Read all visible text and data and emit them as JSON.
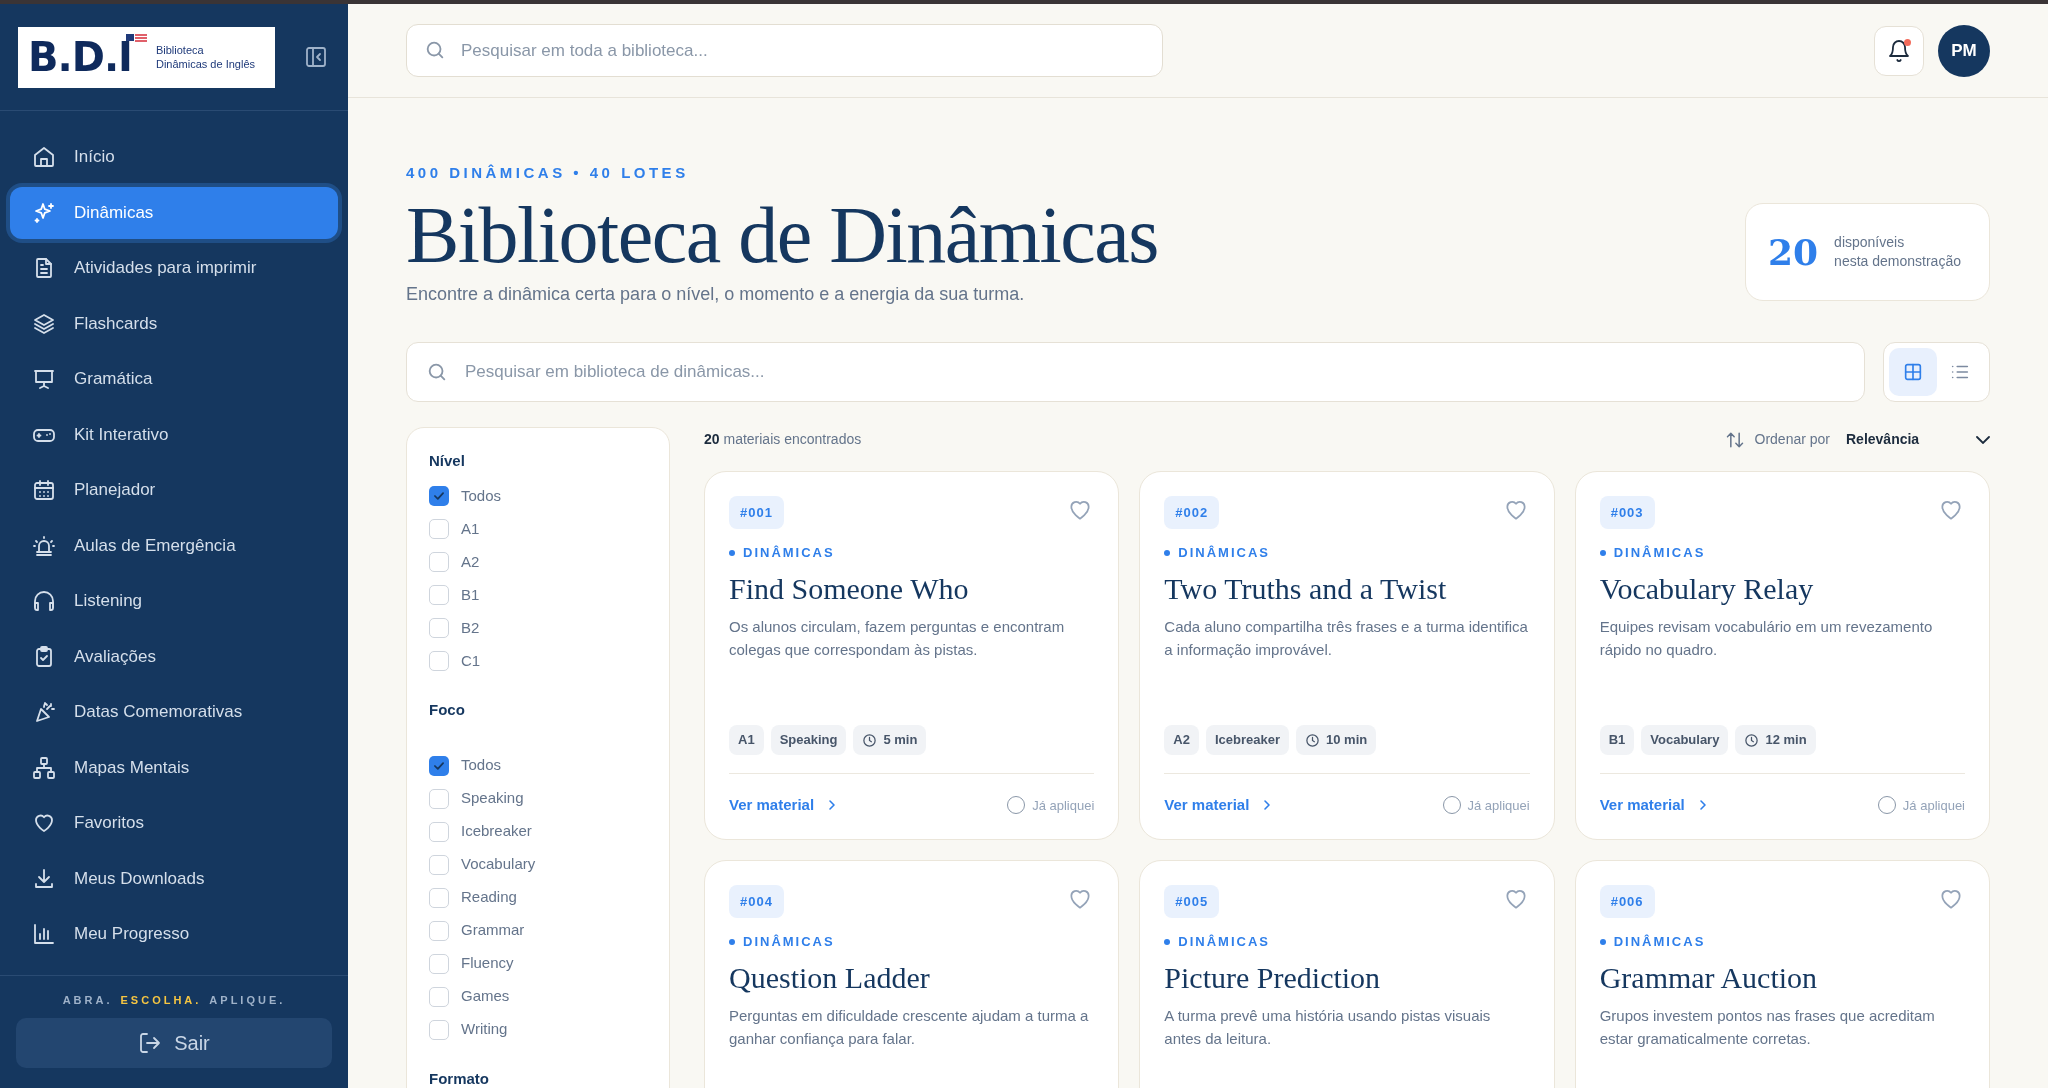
{
  "logo": {
    "letters": "B.D.I",
    "line_1": "Biblioteca",
    "line_2": "Dinâmicas de Inglês"
  },
  "sidebar": {
    "items": [
      {
        "label": "Início",
        "selected": false
      },
      {
        "label": "Dinâmicas",
        "selected": true
      },
      {
        "label": "Atividades para imprimir",
        "selected": false
      },
      {
        "label": "Flashcards",
        "selected": false
      },
      {
        "label": "Gramática",
        "selected": false
      },
      {
        "label": "Kit Interativo",
        "selected": false
      },
      {
        "label": "Planejador",
        "selected": false
      },
      {
        "label": "Aulas de Emergência",
        "selected": false
      },
      {
        "label": "Listening",
        "selected": false
      },
      {
        "label": "Avaliações",
        "selected": false
      },
      {
        "label": "Datas Comemorativas",
        "selected": false
      },
      {
        "label": "Mapas Mentais",
        "selected": false
      },
      {
        "label": "Favoritos",
        "selected": false
      },
      {
        "label": "Meus Downloads",
        "selected": false
      },
      {
        "label": "Meu Progresso",
        "selected": false
      }
    ],
    "tagline": [
      {
        "text": "ABRA.",
        "highlight": false
      },
      {
        "text": "ESCOLHA.",
        "highlight": true
      },
      {
        "text": "APLIQUE.",
        "highlight": false
      }
    ],
    "logout": "Sair"
  },
  "topbar": {
    "search_placeholder": "Pesquisar em toda a biblioteca...",
    "unread_notifications": true,
    "avatar": "PM"
  },
  "hero": {
    "kicker": "400 DINÂMICAS • 40 LOTES",
    "title": "Biblioteca de Dinâmicas",
    "subtitle": "Encontre a dinâmica certa para o nível, o momento e a energia da sua turma.",
    "stat": {
      "value": "20",
      "line_1": "disponíveis",
      "line_2": "nesta demonstração"
    }
  },
  "library_search": {
    "placeholder": "Pesquisar em biblioteca de dinâmicas..."
  },
  "view_modes": [
    {
      "kind": "grid",
      "selected": true
    },
    {
      "kind": "list",
      "selected": false
    }
  ],
  "filters": [
    {
      "title": "Nível",
      "options": [
        {
          "label": "Todos",
          "checked": true
        },
        {
          "label": "A1",
          "checked": false
        },
        {
          "label": "A2",
          "checked": false
        },
        {
          "label": "B1",
          "checked": false
        },
        {
          "label": "B2",
          "checked": false
        },
        {
          "label": "C1",
          "checked": false
        }
      ]
    },
    {
      "title": "Foco",
      "options": [
        {
          "label": "Todos",
          "checked": true
        },
        {
          "label": "Speaking",
          "checked": false
        },
        {
          "label": "Icebreaker",
          "checked": false
        },
        {
          "label": "Vocabulary",
          "checked": false
        },
        {
          "label": "Reading",
          "checked": false
        },
        {
          "label": "Grammar",
          "checked": false
        },
        {
          "label": "Fluency",
          "checked": false
        },
        {
          "label": "Games",
          "checked": false
        },
        {
          "label": "Writing",
          "checked": false
        }
      ]
    },
    {
      "title": "Formato"
    }
  ],
  "results": {
    "count": "20",
    "count_label": "materiais encontrados",
    "sort_label": "Ordenar por",
    "sort_value": "Relevância"
  },
  "cards": [
    {
      "number": "#001",
      "category": "DINÂMICAS",
      "title": "Find Someone Who",
      "description": "Os alunos circulam, fazem perguntas e encontram colegas que correspondam às pistas.",
      "level": "A1",
      "focus": "Speaking",
      "duration": "5 min",
      "favorite": false,
      "link": "Ver material",
      "applied": false,
      "applied_label": "Já apliquei"
    },
    {
      "number": "#002",
      "category": "DINÂMICAS",
      "title": "Two Truths and a Twist",
      "description": "Cada aluno compartilha três frases e a turma identifica a informação improvável.",
      "level": "A2",
      "focus": "Icebreaker",
      "duration": "10 min",
      "favorite": false,
      "link": "Ver material",
      "applied": false,
      "applied_label": "Já apliquei"
    },
    {
      "number": "#003",
      "category": "DINÂMICAS",
      "title": "Vocabulary Relay",
      "description": "Equipes revisam vocabulário em um revezamento rápido no quadro.",
      "level": "B1",
      "focus": "Vocabulary",
      "duration": "12 min",
      "favorite": false,
      "link": "Ver material",
      "applied": false,
      "applied_label": "Já apliquei"
    },
    {
      "number": "#004",
      "category": "DINÂMICAS",
      "title": "Question Ladder",
      "description": "Perguntas em dificuldade crescente ajudam a turma a ganhar confiança para falar.",
      "favorite": false
    },
    {
      "number": "#005",
      "category": "DINÂMICAS",
      "title": "Picture Prediction",
      "description": "A turma prevê uma história usando pistas visuais antes da leitura.",
      "favorite": false
    },
    {
      "number": "#006",
      "category": "DINÂMICAS",
      "title": "Grammar Auction",
      "description": "Grupos investem pontos nas frases que acreditam estar gramaticalmente corretas.",
      "favorite": false
    }
  ]
}
